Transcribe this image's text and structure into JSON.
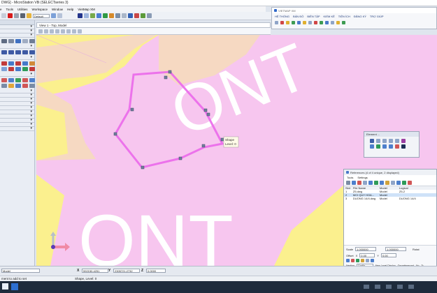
{
  "window": {
    "title": "DWG] - MicroStation V8i (SELECTseries 3)"
  },
  "menu": [
    "e",
    "Tools",
    "Utilities",
    "Workspace",
    "Window",
    "Help",
    "VietMap XM"
  ],
  "toolbar": {
    "level_label": "Default",
    "color_label": "0"
  },
  "view": {
    "title": "View 1 - Top, Model",
    "watermark": "ONT"
  },
  "shape_tip": {
    "line1": "Shape",
    "line2": "Level: 0"
  },
  "ribbon": {
    "title": "VIETMAP XM",
    "tabs": [
      "HỆ THỐNG",
      "BẢN ĐỒ",
      "BIÊN TẬP",
      "KIỂM KÊ",
      "TIỆN ÍCH",
      "ĐĂNG KÝ",
      "TRỢ GIÚP"
    ]
  },
  "element_panel": {
    "title": "Element ..."
  },
  "references": {
    "title": "References (4 of 4 unique, 2 displayed)",
    "menu": [
      "Tools",
      "Settings"
    ],
    "headers": [
      "Slot",
      "File Name",
      "Model",
      "Logical"
    ],
    "rows": [
      {
        "slot": "1",
        "file": "Z5.dwg",
        "model": "Model",
        "logical": "Z5-2"
      },
      {
        "slot": "2",
        "file": "MCI QUY HOA...",
        "model": "Model",
        "logical": ""
      },
      {
        "slot": "3",
        "file": "DUONG 14/4.dwg",
        "model": "Model",
        "logical": "DUONG 14/4"
      }
    ],
    "scale_label": "Scale",
    "scale_value": "1.000000",
    "scale_value2": "1.000000",
    "rotation_label": "Rotat",
    "offset_label": "Offset",
    "offset_x_label": "X",
    "offset_x": "0.00",
    "offset_y_label": "Y",
    "offset_y": "0.00",
    "bottom": {
      "nesting_label": "Nesting",
      "level_display": "Config Variable",
      "new_level_display_label": "New Level Display",
      "georeferenced_label": "Georeferenced",
      "georeferenced_value": "No",
      "tr_label": "Tr"
    }
  },
  "status": {
    "model": "Model",
    "x_label": "X",
    "x_value": "592150.4251",
    "y_label": "Y",
    "y_value": "2305721.2732",
    "z_label": "Z",
    "z_value": "0.0000",
    "message": "ment to add to set",
    "shape_status": "Shape, Level: 0"
  },
  "colors": {
    "pink": "#f7c6ef",
    "yellow": "#fbf08e",
    "cream": "#f6d9c2",
    "shape": "#ea68ea",
    "accent": "#2b5cae"
  }
}
